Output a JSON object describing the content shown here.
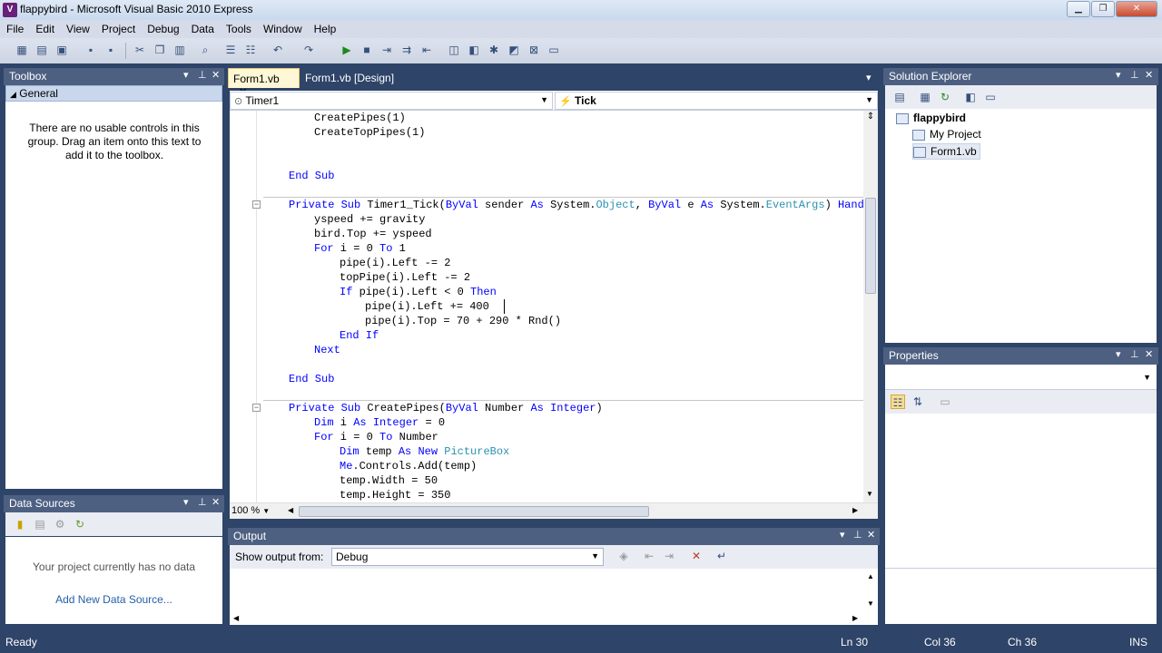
{
  "window": {
    "title": "flappybird - Microsoft Visual Basic 2010 Express"
  },
  "menu": [
    "File",
    "Edit",
    "View",
    "Project",
    "Debug",
    "Data",
    "Tools",
    "Window",
    "Help"
  ],
  "toolbox": {
    "title": "Toolbox",
    "group": "General",
    "message": "There are no usable controls in this group. Drag an item onto this text to add it to the toolbox."
  },
  "data_sources": {
    "title": "Data Sources",
    "message": "Your project currently has no data",
    "link": "Add New Data Source..."
  },
  "editor": {
    "tabs": [
      "Form1.vb",
      "Form1.vb [Design]"
    ],
    "object_combo": "Timer1",
    "method_combo": "Tick",
    "zoom": "100 %",
    "lines": [
      {
        "indent": 2,
        "parts": [
          {
            "t": "CreatePipes(1)"
          }
        ]
      },
      {
        "indent": 2,
        "parts": [
          {
            "t": "CreateTopPipes(1)"
          }
        ]
      },
      {
        "indent": 0,
        "parts": []
      },
      {
        "indent": 0,
        "parts": []
      },
      {
        "indent": 1,
        "parts": [
          {
            "t": "End Sub",
            "c": "kw"
          }
        ]
      },
      {
        "indent": 0,
        "parts": []
      },
      {
        "indent": 1,
        "parts": [
          {
            "t": "Private Sub",
            "c": "kw"
          },
          {
            "t": " Timer1_Tick("
          },
          {
            "t": "ByVal",
            "c": "kw"
          },
          {
            "t": " sender "
          },
          {
            "t": "As",
            "c": "kw"
          },
          {
            "t": " System."
          },
          {
            "t": "Object",
            "c": "ty"
          },
          {
            "t": ", "
          },
          {
            "t": "ByVal",
            "c": "kw"
          },
          {
            "t": " e "
          },
          {
            "t": "As",
            "c": "kw"
          },
          {
            "t": " System."
          },
          {
            "t": "EventArgs",
            "c": "ty"
          },
          {
            "t": ") "
          },
          {
            "t": "Handles",
            "c": "kw"
          }
        ]
      },
      {
        "indent": 2,
        "parts": [
          {
            "t": "yspeed += gravity"
          }
        ]
      },
      {
        "indent": 2,
        "parts": [
          {
            "t": "bird.Top += yspeed"
          }
        ]
      },
      {
        "indent": 2,
        "parts": [
          {
            "t": "For",
            "c": "kw"
          },
          {
            "t": " i = 0 "
          },
          {
            "t": "To",
            "c": "kw"
          },
          {
            "t": " 1"
          }
        ]
      },
      {
        "indent": 3,
        "parts": [
          {
            "t": "pipe(i).Left -= 2"
          }
        ]
      },
      {
        "indent": 3,
        "parts": [
          {
            "t": "topPipe(i).Left -= 2"
          }
        ]
      },
      {
        "indent": 3,
        "parts": [
          {
            "t": "If",
            "c": "kw"
          },
          {
            "t": " pipe(i).Left < 0 "
          },
          {
            "t": "Then",
            "c": "kw"
          }
        ]
      },
      {
        "indent": 4,
        "parts": [
          {
            "t": "pipe(i).Left += 400"
          }
        ]
      },
      {
        "indent": 4,
        "parts": [
          {
            "t": "pipe(i).Top = 70 + 290 * Rnd()"
          }
        ]
      },
      {
        "indent": 3,
        "parts": [
          {
            "t": "End If",
            "c": "kw"
          }
        ]
      },
      {
        "indent": 2,
        "parts": [
          {
            "t": "Next",
            "c": "kw"
          }
        ]
      },
      {
        "indent": 0,
        "parts": []
      },
      {
        "indent": 1,
        "parts": [
          {
            "t": "End Sub",
            "c": "kw"
          }
        ]
      },
      {
        "indent": 0,
        "parts": []
      },
      {
        "indent": 1,
        "parts": [
          {
            "t": "Private Sub",
            "c": "kw"
          },
          {
            "t": " CreatePipes("
          },
          {
            "t": "ByVal",
            "c": "kw"
          },
          {
            "t": " Number "
          },
          {
            "t": "As",
            "c": "kw"
          },
          {
            "t": " "
          },
          {
            "t": "Integer",
            "c": "kw"
          },
          {
            "t": ")"
          }
        ]
      },
      {
        "indent": 2,
        "parts": [
          {
            "t": "Dim",
            "c": "kw"
          },
          {
            "t": " i "
          },
          {
            "t": "As",
            "c": "kw"
          },
          {
            "t": " "
          },
          {
            "t": "Integer",
            "c": "kw"
          },
          {
            "t": " = 0"
          }
        ]
      },
      {
        "indent": 2,
        "parts": [
          {
            "t": "For",
            "c": "kw"
          },
          {
            "t": " i = 0 "
          },
          {
            "t": "To",
            "c": "kw"
          },
          {
            "t": " Number"
          }
        ]
      },
      {
        "indent": 3,
        "parts": [
          {
            "t": "Dim",
            "c": "kw"
          },
          {
            "t": " temp "
          },
          {
            "t": "As",
            "c": "kw"
          },
          {
            "t": " "
          },
          {
            "t": "New",
            "c": "kw"
          },
          {
            "t": " "
          },
          {
            "t": "PictureBox",
            "c": "ty"
          }
        ]
      },
      {
        "indent": 3,
        "parts": [
          {
            "t": "Me",
            "c": "kw"
          },
          {
            "t": ".Controls.Add(temp)"
          }
        ]
      },
      {
        "indent": 3,
        "parts": [
          {
            "t": "temp.Width = 50"
          }
        ]
      },
      {
        "indent": 3,
        "parts": [
          {
            "t": "temp.Height = 350"
          }
        ]
      }
    ]
  },
  "output": {
    "title": "Output",
    "show_label": "Show output from:",
    "source": "Debug"
  },
  "solution_explorer": {
    "title": "Solution Explorer",
    "items": [
      "flappybird",
      "My Project",
      "Form1.vb"
    ]
  },
  "properties": {
    "title": "Properties"
  },
  "status": {
    "ready": "Ready",
    "ln": "Ln 30",
    "col": "Col 36",
    "ch": "Ch 36",
    "mode": "INS"
  }
}
